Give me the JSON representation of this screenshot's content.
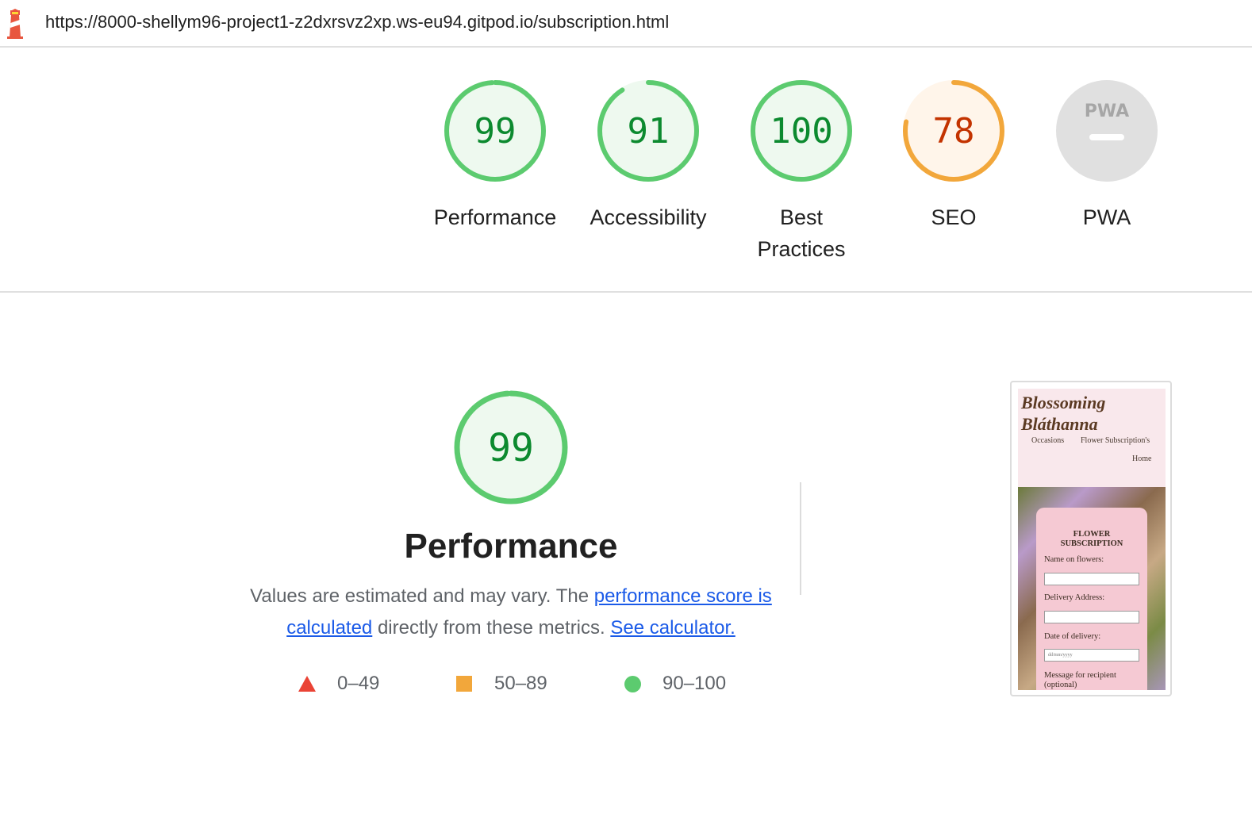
{
  "url_bar": {
    "url": "https://8000-shellym96-project1-z2dxrsvz2xp.ws-eu94.gitpod.io/subscription.html",
    "logo_icon": "lighthouse-icon"
  },
  "gauges": [
    {
      "label": "Performance",
      "score": "99",
      "fraction": 0.99,
      "color": "#0c8a2f"
    },
    {
      "label": "Accessibility",
      "score": "91",
      "fraction": 0.91,
      "color": "#0c8a2f"
    },
    {
      "label": "Best Practices",
      "score": "100",
      "fraction": 1.0,
      "color": "#0c8a2f"
    },
    {
      "label": "SEO",
      "score": "78",
      "fraction": 0.78,
      "color": "#c33300"
    },
    {
      "label": "PWA",
      "score": "",
      "badge_text": "PWA",
      "color": "#9e9e9e"
    }
  ],
  "colors": {
    "pass_stroke": "#5ccb6f",
    "pass_fill": "#eef9ef",
    "average_stroke": "#f2a73b",
    "average_fill": "#fff5ea",
    "fail": "#ea4335",
    "na_fill": "#e0e0e0",
    "link": "#1a5ae8"
  },
  "performance": {
    "score": "99",
    "fraction": 0.99,
    "title": "Performance",
    "desc_before": "Values are estimated and may vary. The ",
    "link_score": "performance score is calculated",
    "desc_middle": " directly from these metrics. ",
    "link_calculator": "See calculator."
  },
  "legend": [
    {
      "range": "0–49",
      "shape": "triangle",
      "color": "#ea4335"
    },
    {
      "range": "50–89",
      "shape": "square",
      "color": "#f2a73b"
    },
    {
      "range": "90–100",
      "shape": "circle",
      "color": "#5ccb6f"
    }
  ],
  "thumbnail": {
    "brand": "Blossoming Bláthanna",
    "nav_occasions": "Occasions",
    "nav_subscriptions": "Flower Subscription's",
    "nav_home": "Home",
    "form_title": "FLOWER SUBSCRIPTION",
    "label_name": "Name on flowers:",
    "label_address": "Delivery Address:",
    "label_date": "Date of delivery:",
    "date_placeholder": "dd/mm/yyyy",
    "label_message": "Message for recipient (optional)"
  }
}
